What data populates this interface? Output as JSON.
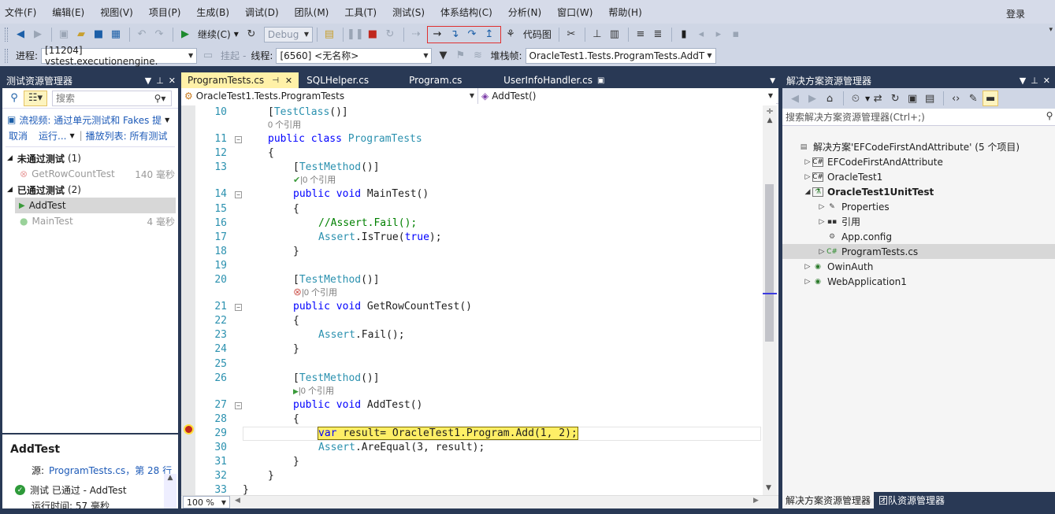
{
  "menu": [
    "文件(F)",
    "编辑(E)",
    "视图(V)",
    "项目(P)",
    "生成(B)",
    "调试(D)",
    "团队(M)",
    "工具(T)",
    "测试(S)",
    "体系结构(C)",
    "分析(N)",
    "窗口(W)",
    "帮助(H)"
  ],
  "login": "登录",
  "toolbar1": {
    "continue_label": "继续(C)",
    "config": "Debug",
    "codemap_label": "代码图"
  },
  "toolbar2": {
    "process_label": "进程:",
    "process_value": "[11204] vstest.executionengine.",
    "suspend_label": "挂起",
    "thread_label": "线程:",
    "thread_value": "[6560] <无名称>",
    "stackframe_label": "堆栈帧:",
    "stackframe_value": "OracleTest1.Tests.ProgramTests.AddT"
  },
  "test_explorer": {
    "title": "测试资源管理器",
    "search_placeholder": "搜索",
    "info_bar": "流视频: 通过单元测试和 Fakes 提",
    "cancel": "取消",
    "run": "运行...",
    "playlist": "播放列表: 所有测试",
    "failed_group": "未通过测试",
    "failed_count": "(1)",
    "failed_tests": [
      {
        "name": "GetRowCountTest",
        "time": "140 毫秒"
      }
    ],
    "passed_group": "已通过测试",
    "passed_count": "(2)",
    "passed_tests": [
      {
        "name": "AddTest",
        "time": ""
      },
      {
        "name": "MainTest",
        "time": "4 毫秒"
      }
    ],
    "detail_title": "AddTest",
    "detail_source_label": "源:",
    "detail_source_link": "ProgramTests.cs，第 28 行",
    "detail_status": "测试 已通过 - AddTest",
    "detail_runtime": "运行时间: 57 毫秒"
  },
  "editor": {
    "tabs": [
      "ProgramTests.cs",
      "SQLHelper.cs",
      "Program.cs",
      "UserInfoHandler.cs"
    ],
    "nav_class": "OracleTest1.Tests.ProgramTests",
    "nav_member": "AddTest()",
    "zoom": "100 %",
    "lines": [
      {
        "n": "10",
        "t": "[TestClass()]",
        "lens": "0 个引用"
      },
      {
        "n": "11",
        "t": "public class ProgramTests"
      },
      {
        "n": "12",
        "t": "{"
      },
      {
        "n": "13",
        "t": "[TestMethod()]",
        "lens": "|0 个引用",
        "lensIcon": "pass"
      },
      {
        "n": "14",
        "t": "public void MainTest()"
      },
      {
        "n": "15",
        "t": "{"
      },
      {
        "n": "16",
        "t": "//Assert.Fail();"
      },
      {
        "n": "17",
        "t": "Assert.IsTrue(true);"
      },
      {
        "n": "18",
        "t": "}"
      },
      {
        "n": "19",
        "t": ""
      },
      {
        "n": "20",
        "t": "[TestMethod()]",
        "lens": "|0 个引用",
        "lensIcon": "fail"
      },
      {
        "n": "21",
        "t": "public void GetRowCountTest()"
      },
      {
        "n": "22",
        "t": "{"
      },
      {
        "n": "23",
        "t": "Assert.Fail();"
      },
      {
        "n": "24",
        "t": "}"
      },
      {
        "n": "25",
        "t": ""
      },
      {
        "n": "26",
        "t": "[TestMethod()]",
        "lens": "|0 个引用",
        "lensIcon": "run"
      },
      {
        "n": "27",
        "t": "public void AddTest()"
      },
      {
        "n": "28",
        "t": "{"
      },
      {
        "n": "29",
        "t": "var result= OracleTest1.Program.Add(1, 2);"
      },
      {
        "n": "30",
        "t": "Assert.AreEqual(3, result);"
      },
      {
        "n": "31",
        "t": "}"
      },
      {
        "n": "32",
        "t": "}"
      },
      {
        "n": "33",
        "t": "}"
      }
    ]
  },
  "solution_explorer": {
    "title": "解决方案资源管理器",
    "search_placeholder": "搜索解决方案资源管理器(Ctrl+;)",
    "items": [
      {
        "label": "解决方案'EFCodeFirstAndAttribute' (5 个项目)",
        "level": 0,
        "icon": "sln"
      },
      {
        "label": "EFCodeFirstAndAttribute",
        "level": 1,
        "icon": "cs"
      },
      {
        "label": "OracleTest1",
        "level": 1,
        "icon": "cs"
      },
      {
        "label": "OracleTest1UnitTest",
        "level": 1,
        "icon": "test"
      },
      {
        "label": "Properties",
        "level": 2,
        "icon": "wrench"
      },
      {
        "label": "引用",
        "level": 2,
        "icon": "ref"
      },
      {
        "label": "App.config",
        "level": 2,
        "icon": "config"
      },
      {
        "label": "ProgramTests.cs",
        "level": 2,
        "icon": "csfile"
      },
      {
        "label": "OwinAuth",
        "level": 1,
        "icon": "web"
      },
      {
        "label": "WebApplication1",
        "level": 1,
        "icon": "web"
      }
    ],
    "bottom_tabs": [
      "解决方案资源管理器",
      "团队资源管理器"
    ]
  },
  "colors": {
    "chrome": "#293955",
    "menu": "#d6dbe9",
    "active_tab": "#fff1a8",
    "highlight": "#ffef66",
    "selection": "#cce0f5"
  }
}
